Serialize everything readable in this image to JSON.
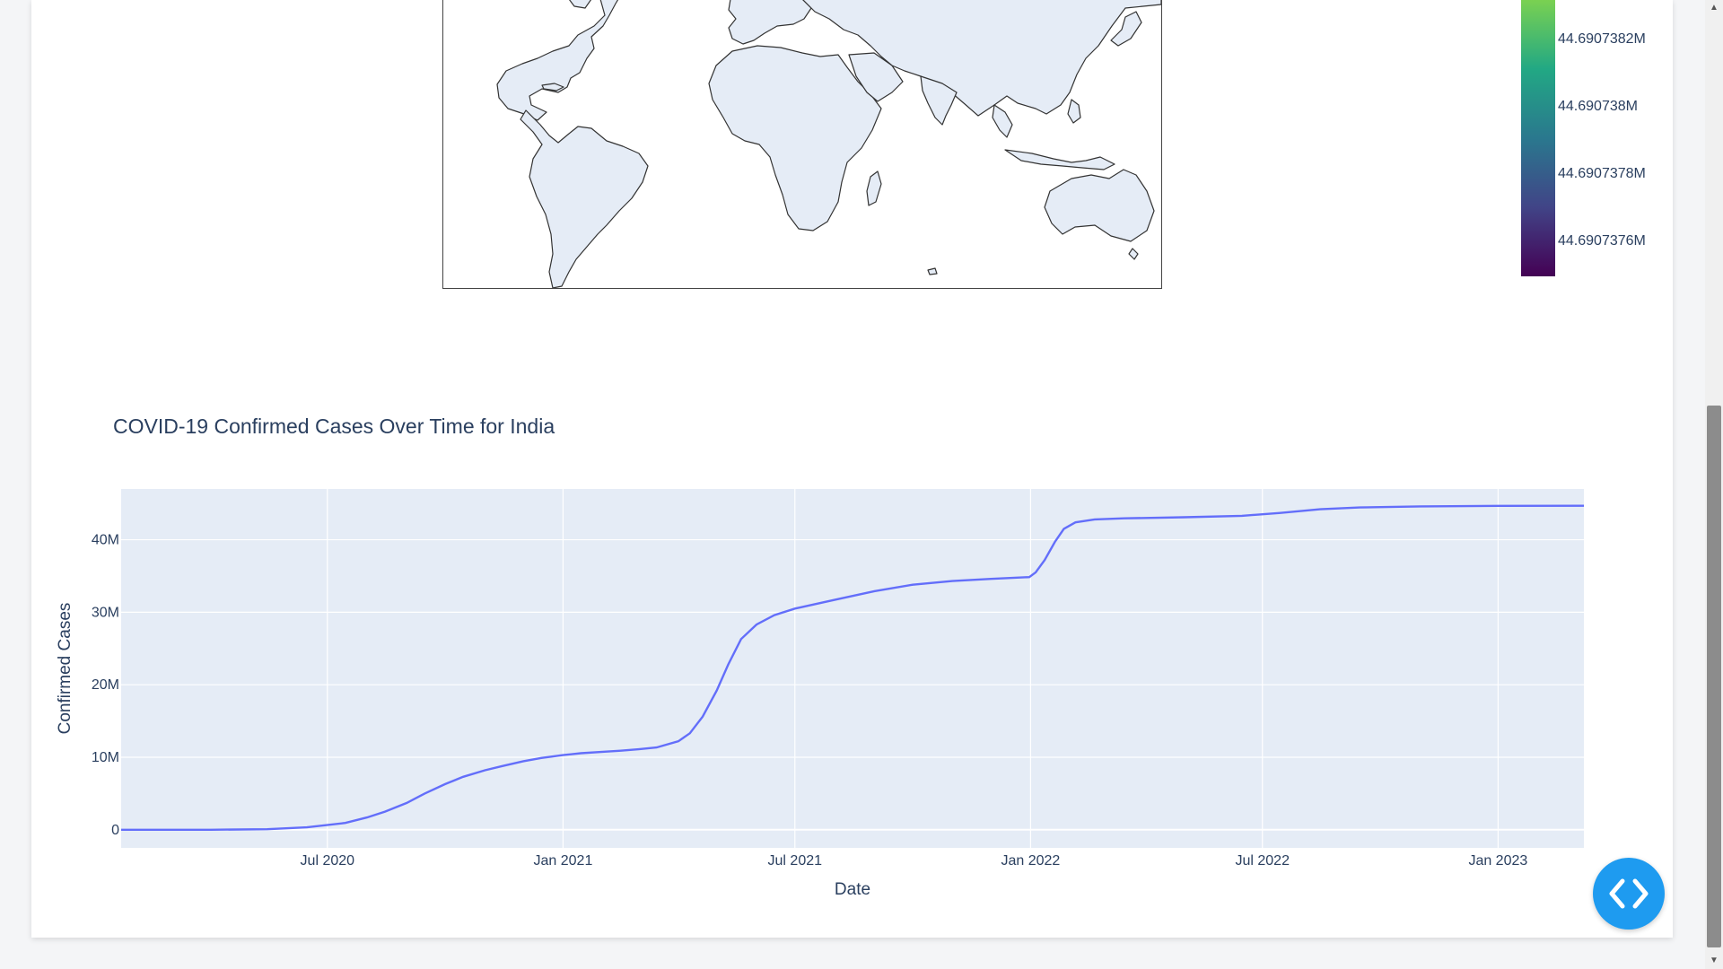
{
  "colorbar": {
    "ticks": [
      "44.6907382M",
      "44.690738M",
      "44.6907378M",
      "44.6907376M"
    ],
    "colors": [
      "#7ad151",
      "#22a884",
      "#2a788e",
      "#414487",
      "#440154"
    ]
  },
  "chart_data": {
    "type": "line",
    "title": "COVID-19 Confirmed Cases Over Time for India",
    "xlabel": "Date",
    "ylabel": "Confirmed Cases",
    "x_tick_labels": [
      "Jul 2020",
      "Jan 2021",
      "Jul 2021",
      "Jan 2022",
      "Jul 2022",
      "Jan 2023"
    ],
    "x_tick_dates": [
      "2020-07-01",
      "2021-01-01",
      "2021-07-01",
      "2022-01-01",
      "2022-07-01",
      "2023-01-01"
    ],
    "y_tick_labels": [
      "0",
      "10M",
      "20M",
      "30M",
      "40M"
    ],
    "y_tick_values": [
      0,
      10000000,
      20000000,
      30000000,
      40000000
    ],
    "xlim": [
      "2020-01-22",
      "2023-03-09"
    ],
    "ylim": [
      -2500000,
      47000000
    ],
    "grid": true,
    "line_color": "#636efa",
    "plot_bg": "#e5ecf6",
    "series": [
      {
        "x": [
          "2020-01-22",
          "2020-04-01",
          "2020-05-15",
          "2020-06-15",
          "2020-07-15",
          "2020-08-01",
          "2020-08-15",
          "2020-09-01",
          "2020-09-15",
          "2020-10-01",
          "2020-10-15",
          "2020-11-01",
          "2020-11-15",
          "2020-12-01",
          "2020-12-15",
          "2021-01-01",
          "2021-01-15",
          "2021-02-01",
          "2021-02-15",
          "2021-03-01",
          "2021-03-15",
          "2021-04-01",
          "2021-04-10",
          "2021-04-20",
          "2021-05-01",
          "2021-05-10",
          "2021-05-20",
          "2021-06-01",
          "2021-06-15",
          "2021-07-01",
          "2021-08-01",
          "2021-09-01",
          "2021-10-01",
          "2021-11-01",
          "2021-12-01",
          "2021-12-31",
          "2022-01-05",
          "2022-01-12",
          "2022-01-20",
          "2022-01-27",
          "2022-02-05",
          "2022-02-20",
          "2022-03-15",
          "2022-05-01",
          "2022-06-15",
          "2022-07-15",
          "2022-08-15",
          "2022-09-15",
          "2022-11-01",
          "2023-01-01",
          "2023-03-09"
        ],
        "y": [
          0,
          1800,
          80000,
          330000,
          940000,
          1700000,
          2500000,
          3700000,
          5000000,
          6300000,
          7300000,
          8200000,
          8800000,
          9450000,
          9900000,
          10300000,
          10550000,
          10750000,
          10900000,
          11100000,
          11350000,
          12200000,
          13300000,
          15600000,
          19200000,
          22800000,
          26300000,
          28300000,
          29600000,
          30500000,
          31700000,
          32900000,
          33800000,
          34300000,
          34600000,
          34850000,
          35500000,
          37200000,
          39700000,
          41500000,
          42400000,
          42800000,
          42950000,
          43100000,
          43300000,
          43700000,
          44200000,
          44450000,
          44600000,
          44670000,
          44690000
        ]
      }
    ]
  }
}
